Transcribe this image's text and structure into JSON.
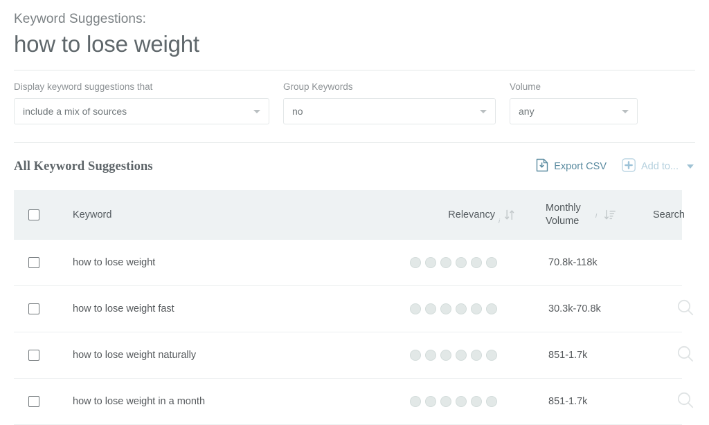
{
  "header": {
    "eyebrow": "Keyword Suggestions:",
    "title": "how to lose weight"
  },
  "filters": [
    {
      "label": "Display keyword suggestions that",
      "value": "include a mix of sources",
      "name": "sources-filter"
    },
    {
      "label": "Group Keywords",
      "value": "no",
      "name": "group-keywords-filter"
    },
    {
      "label": "Volume",
      "value": "any",
      "name": "volume-filter"
    }
  ],
  "section": {
    "title": "All Keyword Suggestions",
    "export_label": "Export CSV",
    "addto_label": "Add to...",
    "export_icon": "document-download-icon",
    "addto_icon": "plus-icon",
    "addto_caret_icon": "chevron-down-icon"
  },
  "table": {
    "columns": {
      "keyword": "Keyword",
      "relevancy": "Relevancy",
      "monthly_volume_line1": "Monthly",
      "monthly_volume_line2": "Volume",
      "search": "Search",
      "info_marker": "i"
    },
    "icons": {
      "relevancy_sort": "sort-ascending-descending-icon",
      "volume_sort": "sort-descending-icon",
      "row_search": "magnifier-icon",
      "checkbox": "checkbox-unchecked-icon"
    },
    "rows": [
      {
        "keyword": "how to lose weight",
        "relevancy_dots": 6,
        "volume": "70.8k-118k",
        "has_search": false
      },
      {
        "keyword": "how to lose weight fast",
        "relevancy_dots": 6,
        "volume": "30.3k-70.8k",
        "has_search": true
      },
      {
        "keyword": "how to lose weight naturally",
        "relevancy_dots": 6,
        "volume": "851-1.7k",
        "has_search": true
      },
      {
        "keyword": "how to lose weight in a month",
        "relevancy_dots": 6,
        "volume": "851-1.7k",
        "has_search": true
      }
    ]
  },
  "colors": {
    "accent_link": "#5a8ba0",
    "accent_disabled": "#b3cfdd",
    "header_band": "#eef2f3",
    "dot": "#e2e8e7"
  }
}
